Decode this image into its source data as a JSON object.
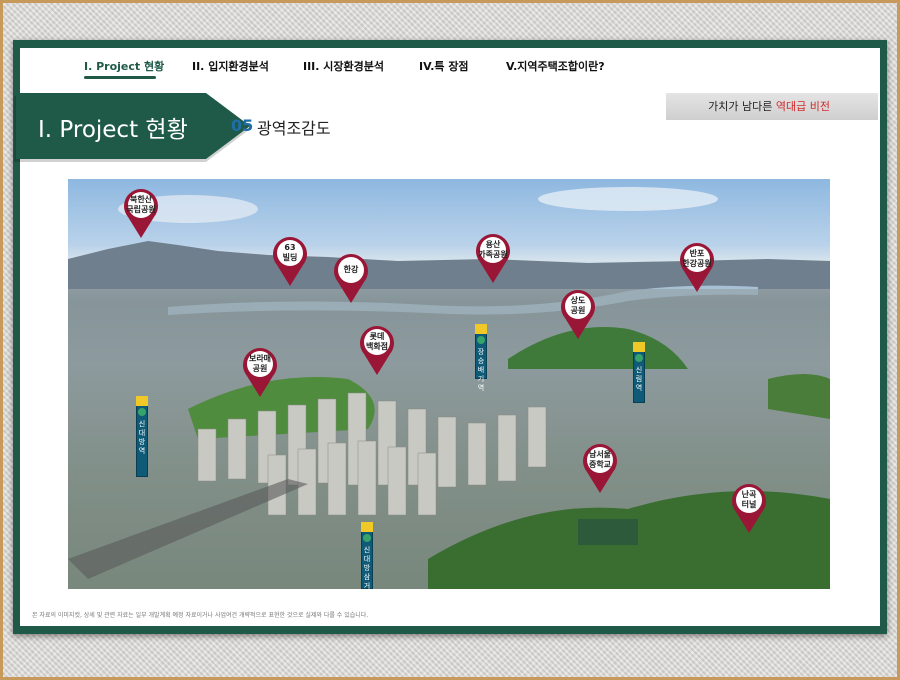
{
  "nav": {
    "items": [
      {
        "label": "I. Project 현황",
        "active": true
      },
      {
        "label": "II. 입지환경분석",
        "active": false
      },
      {
        "label": "III. 시장환경분석",
        "active": false
      },
      {
        "label": "IV.특 장점",
        "active": false
      },
      {
        "label": "V.지역주택조합이란?",
        "active": false
      }
    ]
  },
  "header": {
    "title": "I. Project 현황",
    "section_number": "05",
    "section_title": "광역조감도",
    "slogan_prefix": "가치가 남다른 ",
    "slogan_highlight": "역대급 비전"
  },
  "map": {
    "pins": [
      {
        "label": "북한산\n국립공원"
      },
      {
        "label": "63\n빌딩"
      },
      {
        "label": "한강"
      },
      {
        "label": "용산\n가족공원"
      },
      {
        "label": "반포\n한강공원"
      },
      {
        "label": "상도\n공원"
      },
      {
        "label": "롯데\n백화점"
      },
      {
        "label": "보라매\n공원"
      },
      {
        "label": "남서울\n중학교"
      },
      {
        "label": "난곡\n터널"
      }
    ],
    "stations": [
      {
        "label": "신대방역"
      },
      {
        "label": "장승배기역"
      },
      {
        "label": "신림역"
      },
      {
        "label": "신대방삼거리역"
      }
    ]
  },
  "footer": {
    "disclaimer": "본 자료의 이미지컷, 상세 및 관련 자료는 일부 개발계획 예정 자료이거나 사업여건 개략적으로 표현한 것으로 실제와 다를 수 있습니다."
  },
  "colors": {
    "brand_green": "#1f5a48",
    "pin_red": "#9a1636",
    "highlight_red": "#d22a2a",
    "section_blue": "#1f6ea8"
  }
}
